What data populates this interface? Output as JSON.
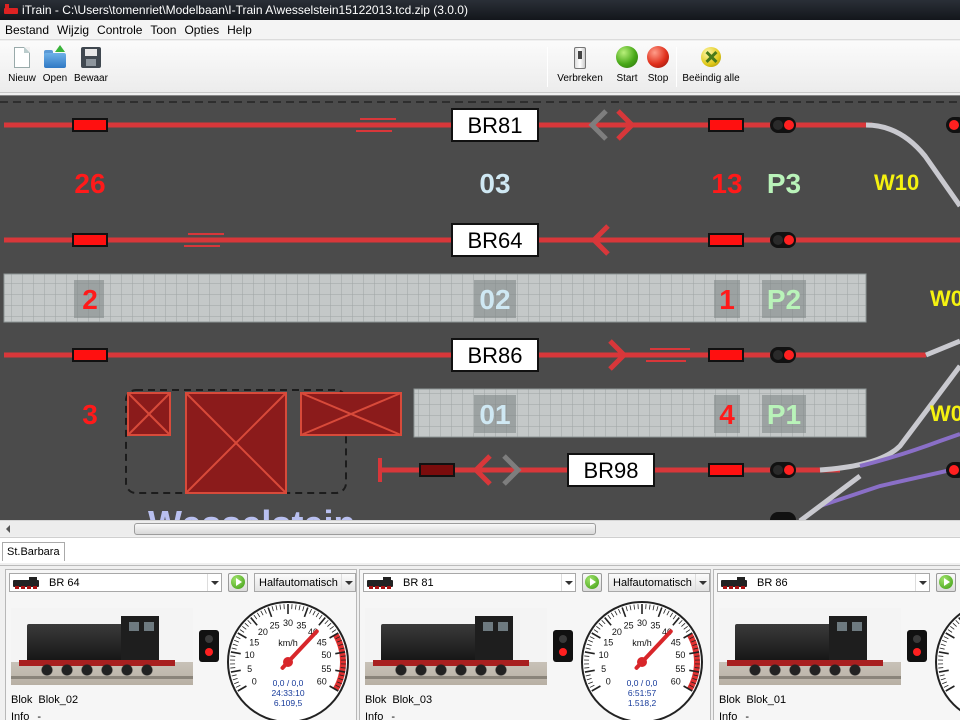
{
  "window": {
    "title": "iTrain - C:\\Users\\tomenriet\\Modelbaan\\I-Train A\\wesselstein15122013.tcd.zip (3.0.0)"
  },
  "menu": [
    "Bestand",
    "Wijzig",
    "Controle",
    "Toon",
    "Opties",
    "Help"
  ],
  "toolbar": {
    "new": "Nieuw",
    "open": "Open",
    "save": "Bewaar",
    "disconnect": "Verbreken",
    "start": "Start",
    "stop": "Stop",
    "end_all": "Beëindig alle"
  },
  "track": {
    "train_labels": [
      "BR81",
      "BR64",
      "BR86",
      "BR98"
    ],
    "left_numbers": [
      "26",
      "2",
      "3"
    ],
    "block_ids": [
      "03",
      "02",
      "01"
    ],
    "right_numbers": [
      "13",
      "1",
      "4"
    ],
    "platforms": [
      "P3",
      "P2",
      "P1"
    ],
    "switches": [
      "W10",
      "W0",
      "W0"
    ],
    "colors": {
      "background": "#4b4b4b",
      "track_occupied": "#d8373a",
      "block_id": "#cfe8f3",
      "number_red": "#ff1a1a",
      "platform_green": "#b9f3b9",
      "switch_yellow": "#f5f210"
    }
  },
  "tabs": [
    "St.Barbara"
  ],
  "locos": [
    {
      "name": "BR 64",
      "mode": "Halfautomatisch",
      "block_label": "Blok",
      "block_value": "Blok_02",
      "info_label": "Info",
      "info_value": "-",
      "speed_unit": "km/h",
      "speed_readout": "0,0 / 0,0",
      "time": "24:33:10",
      "odometer": "6.109,5",
      "dial_ticks": [
        "0",
        "5",
        "10",
        "15",
        "20",
        "25",
        "30",
        "35",
        "40",
        "45",
        "50",
        "55",
        "60"
      ]
    },
    {
      "name": "BR 81",
      "mode": "Halfautomatisch",
      "block_label": "Blok",
      "block_value": "Blok_03",
      "info_label": "Info",
      "info_value": "-",
      "speed_unit": "km/h",
      "speed_readout": "0,0 / 0,0",
      "time": "6:51:57",
      "odometer": "1.518,2",
      "dial_ticks": [
        "0",
        "5",
        "10",
        "15",
        "20",
        "25",
        "30",
        "35",
        "40",
        "45",
        "50",
        "55",
        "60"
      ]
    },
    {
      "name": "BR 86",
      "mode": "",
      "block_label": "Blok",
      "block_value": "Blok_01",
      "info_label": "Info",
      "info_value": "-",
      "speed_unit": "km/h",
      "speed_readout": "",
      "time": "",
      "odometer": "",
      "dial_ticks": []
    }
  ]
}
